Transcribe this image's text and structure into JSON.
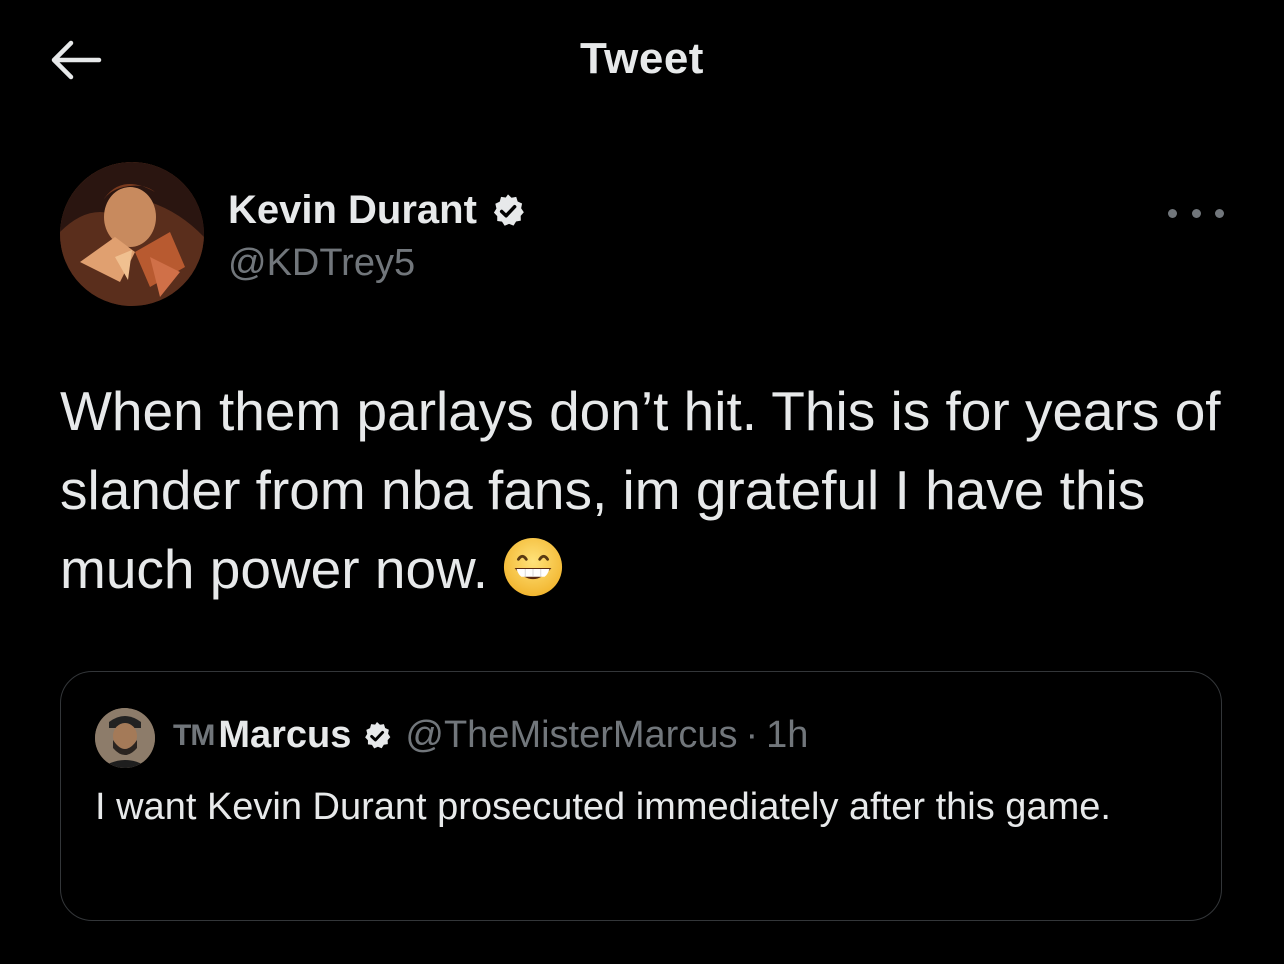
{
  "header": {
    "title": "Tweet",
    "back_icon": "arrow-left-icon"
  },
  "tweet": {
    "author": {
      "name": "Kevin Durant",
      "handle": "@KDTrey5",
      "verified": true
    },
    "text": "When them parlays don’t hit. This is for years of slander from nba fans, im grateful I have this much power now.",
    "emoji": "grinning-face-with-smiling-eyes",
    "more_icon": "more-dots-icon"
  },
  "quote": {
    "prefix": "TM",
    "name": "Marcus",
    "verified": true,
    "handle": "@TheMisterMarcus",
    "separator": "·",
    "time": "1h",
    "text": "I want Kevin Durant prosecuted immediately after this game."
  },
  "colors": {
    "background": "#000000",
    "text_primary": "#e7e9ea",
    "text_secondary": "#71767b",
    "border": "#333639",
    "verified_badge": "#e7e9ea"
  }
}
